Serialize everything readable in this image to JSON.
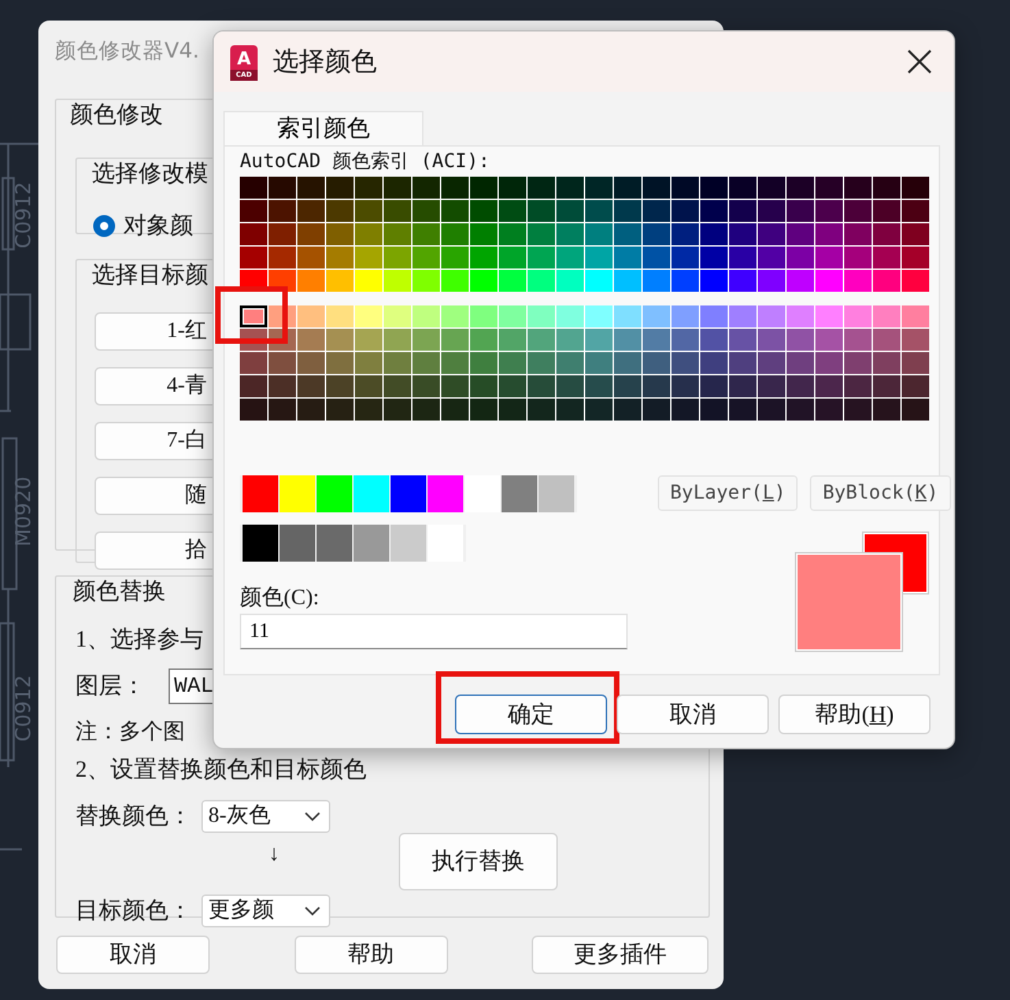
{
  "background": {
    "cad_labels": [
      "C0912",
      "M0920",
      "C0912"
    ]
  },
  "modifier_window": {
    "title": "颜色修改器V4.",
    "modify_group": {
      "title": "颜色修改",
      "mode_group": {
        "title": "选择修改模",
        "options": [
          {
            "label": "对象颜",
            "selected": true
          }
        ]
      },
      "target_group": {
        "title": "选择目标颜",
        "buttons": [
          "1-红",
          "4-青",
          "7-白",
          "随",
          "拾"
        ]
      }
    },
    "replace_group": {
      "title": "颜色替换",
      "step1": "1、选择参与",
      "layer_label": "图层：",
      "layer_value": "WAL",
      "note": "注：多个图",
      "step2": "2、设置替换颜色和目标颜色",
      "replace_label": "替换颜色：",
      "replace_value": "8-灰色",
      "arrow": "↓",
      "target_label": "目标颜色：",
      "target_value": "更多颜",
      "execute_button": "执行替换"
    },
    "buttons": [
      "取消",
      "帮助",
      "更多插件"
    ]
  },
  "color_dialog": {
    "title": "选择颜色",
    "logo": {
      "letter": "A",
      "caption": "CAD"
    },
    "tabs": [
      {
        "label": "索引颜色",
        "selected": true
      }
    ],
    "aci_label": "AutoCAD 颜色索引 (ACI):",
    "aci_upper": [
      {
        "cells": [
          {
            "color": "#260000",
            "selected": false
          },
          {
            "color": "#260900",
            "selected": false
          },
          {
            "color": "#261300",
            "selected": false
          },
          {
            "color": "#261c00",
            "selected": false
          },
          {
            "color": "#262600",
            "selected": false
          },
          {
            "color": "#1c2600",
            "selected": false
          },
          {
            "color": "#132600",
            "selected": false
          },
          {
            "color": "#092600",
            "selected": false
          },
          {
            "color": "#002600",
            "selected": false
          },
          {
            "color": "#002609",
            "selected": false
          },
          {
            "color": "#002613",
            "selected": false
          },
          {
            "color": "#00261c",
            "selected": false
          },
          {
            "color": "#002626",
            "selected": false
          },
          {
            "color": "#001c26",
            "selected": false
          },
          {
            "color": "#001326",
            "selected": false
          },
          {
            "color": "#000926",
            "selected": false
          },
          {
            "color": "#000026",
            "selected": false
          },
          {
            "color": "#090026",
            "selected": false
          },
          {
            "color": "#130026",
            "selected": false
          },
          {
            "color": "#1c0026",
            "selected": false
          },
          {
            "color": "#260026",
            "selected": false
          },
          {
            "color": "#26001c",
            "selected": false
          },
          {
            "color": "#260013",
            "selected": false
          },
          {
            "color": "#260009",
            "selected": false
          }
        ]
      },
      {
        "cells": [
          {
            "color": "#4c0000",
            "selected": false
          },
          {
            "color": "#4c1300",
            "selected": false
          },
          {
            "color": "#4c2600",
            "selected": false
          },
          {
            "color": "#4c3900",
            "selected": false
          },
          {
            "color": "#4c4c00",
            "selected": false
          },
          {
            "color": "#394c00",
            "selected": false
          },
          {
            "color": "#264c00",
            "selected": false
          },
          {
            "color": "#134c00",
            "selected": false
          },
          {
            "color": "#004c00",
            "selected": false
          },
          {
            "color": "#004c13",
            "selected": false
          },
          {
            "color": "#004c26",
            "selected": false
          },
          {
            "color": "#004c39",
            "selected": false
          },
          {
            "color": "#004c4c",
            "selected": false
          },
          {
            "color": "#00394c",
            "selected": false
          },
          {
            "color": "#00264c",
            "selected": false
          },
          {
            "color": "#00134c",
            "selected": false
          },
          {
            "color": "#00004c",
            "selected": false
          },
          {
            "color": "#13004c",
            "selected": false
          },
          {
            "color": "#26004c",
            "selected": false
          },
          {
            "color": "#39004c",
            "selected": false
          },
          {
            "color": "#4c004c",
            "selected": false
          },
          {
            "color": "#4c0039",
            "selected": false
          },
          {
            "color": "#4c0026",
            "selected": false
          },
          {
            "color": "#4c0013",
            "selected": false
          }
        ]
      },
      {
        "cells": [
          {
            "color": "#7f0000",
            "selected": false
          },
          {
            "color": "#7f1f00",
            "selected": false
          },
          {
            "color": "#7f3f00",
            "selected": false
          },
          {
            "color": "#7f5f00",
            "selected": false
          },
          {
            "color": "#7f7f00",
            "selected": false
          },
          {
            "color": "#5f7f00",
            "selected": false
          },
          {
            "color": "#3f7f00",
            "selected": false
          },
          {
            "color": "#1f7f00",
            "selected": false
          },
          {
            "color": "#007f00",
            "selected": false
          },
          {
            "color": "#007f1f",
            "selected": false
          },
          {
            "color": "#007f3f",
            "selected": false
          },
          {
            "color": "#007f5f",
            "selected": false
          },
          {
            "color": "#007f7f",
            "selected": false
          },
          {
            "color": "#005f7f",
            "selected": false
          },
          {
            "color": "#003f7f",
            "selected": false
          },
          {
            "color": "#001f7f",
            "selected": false
          },
          {
            "color": "#00007f",
            "selected": false
          },
          {
            "color": "#1f007f",
            "selected": false
          },
          {
            "color": "#3f007f",
            "selected": false
          },
          {
            "color": "#5f007f",
            "selected": false
          },
          {
            "color": "#7f007f",
            "selected": false
          },
          {
            "color": "#7f005f",
            "selected": false
          },
          {
            "color": "#7f003f",
            "selected": false
          },
          {
            "color": "#7f001f",
            "selected": false
          }
        ]
      },
      {
        "cells": [
          {
            "color": "#a50000",
            "selected": false
          },
          {
            "color": "#a52900",
            "selected": false
          },
          {
            "color": "#a55200",
            "selected": false
          },
          {
            "color": "#a57c00",
            "selected": false
          },
          {
            "color": "#a5a500",
            "selected": false
          },
          {
            "color": "#7ca500",
            "selected": false
          },
          {
            "color": "#52a500",
            "selected": false
          },
          {
            "color": "#29a500",
            "selected": false
          },
          {
            "color": "#00a500",
            "selected": false
          },
          {
            "color": "#00a529",
            "selected": false
          },
          {
            "color": "#00a552",
            "selected": false
          },
          {
            "color": "#00a57c",
            "selected": false
          },
          {
            "color": "#00a5a5",
            "selected": false
          },
          {
            "color": "#007ca5",
            "selected": false
          },
          {
            "color": "#0052a5",
            "selected": false
          },
          {
            "color": "#0029a5",
            "selected": false
          },
          {
            "color": "#0000a5",
            "selected": false
          },
          {
            "color": "#2900a5",
            "selected": false
          },
          {
            "color": "#5200a5",
            "selected": false
          },
          {
            "color": "#7c00a5",
            "selected": false
          },
          {
            "color": "#a500a5",
            "selected": false
          },
          {
            "color": "#a5007c",
            "selected": false
          },
          {
            "color": "#a50052",
            "selected": false
          },
          {
            "color": "#a50029",
            "selected": false
          }
        ]
      },
      {
        "cells": [
          {
            "color": "#ff0000",
            "selected": false
          },
          {
            "color": "#ff3f00",
            "selected": false
          },
          {
            "color": "#ff7f00",
            "selected": false
          },
          {
            "color": "#ffbf00",
            "selected": false
          },
          {
            "color": "#ffff00",
            "selected": false
          },
          {
            "color": "#bfff00",
            "selected": false
          },
          {
            "color": "#7fff00",
            "selected": false
          },
          {
            "color": "#3fff00",
            "selected": false
          },
          {
            "color": "#00ff00",
            "selected": false
          },
          {
            "color": "#00ff3f",
            "selected": false
          },
          {
            "color": "#00ff7f",
            "selected": false
          },
          {
            "color": "#00ffbf",
            "selected": false
          },
          {
            "color": "#00ffff",
            "selected": false
          },
          {
            "color": "#00bfff",
            "selected": false
          },
          {
            "color": "#007fff",
            "selected": false
          },
          {
            "color": "#003fff",
            "selected": false
          },
          {
            "color": "#0000ff",
            "selected": false
          },
          {
            "color": "#3f00ff",
            "selected": false
          },
          {
            "color": "#7f00ff",
            "selected": false
          },
          {
            "color": "#bf00ff",
            "selected": false
          },
          {
            "color": "#ff00ff",
            "selected": false
          },
          {
            "color": "#ff00bf",
            "selected": false
          },
          {
            "color": "#ff007f",
            "selected": false
          },
          {
            "color": "#ff003f",
            "selected": false
          }
        ]
      }
    ],
    "aci_lower": [
      {
        "cells": [
          {
            "color": "#ff7f7f",
            "selected": true
          },
          {
            "color": "#ff9f7f",
            "selected": false
          },
          {
            "color": "#ffbf7f",
            "selected": false
          },
          {
            "color": "#ffdf7f",
            "selected": false
          },
          {
            "color": "#ffff7f",
            "selected": false
          },
          {
            "color": "#dfff7f",
            "selected": false
          },
          {
            "color": "#bfff7f",
            "selected": false
          },
          {
            "color": "#9fff7f",
            "selected": false
          },
          {
            "color": "#7fff7f",
            "selected": false
          },
          {
            "color": "#7fff9f",
            "selected": false
          },
          {
            "color": "#7fffbf",
            "selected": false
          },
          {
            "color": "#7fffdf",
            "selected": false
          },
          {
            "color": "#7fffff",
            "selected": false
          },
          {
            "color": "#7fdfff",
            "selected": false
          },
          {
            "color": "#7fbfff",
            "selected": false
          },
          {
            "color": "#7f9fff",
            "selected": false
          },
          {
            "color": "#7f7fff",
            "selected": false
          },
          {
            "color": "#9f7fff",
            "selected": false
          },
          {
            "color": "#bf7fff",
            "selected": false
          },
          {
            "color": "#df7fff",
            "selected": false
          },
          {
            "color": "#ff7fff",
            "selected": false
          },
          {
            "color": "#ff7fdf",
            "selected": false
          },
          {
            "color": "#ff7fbf",
            "selected": false
          },
          {
            "color": "#ff7f9f",
            "selected": false
          }
        ]
      },
      {
        "cells": [
          {
            "color": "#a55252",
            "selected": false
          },
          {
            "color": "#a56752",
            "selected": false
          },
          {
            "color": "#a57c52",
            "selected": false
          },
          {
            "color": "#a59052",
            "selected": false
          },
          {
            "color": "#a5a552",
            "selected": false
          },
          {
            "color": "#90a552",
            "selected": false
          },
          {
            "color": "#7ca552",
            "selected": false
          },
          {
            "color": "#67a552",
            "selected": false
          },
          {
            "color": "#52a552",
            "selected": false
          },
          {
            "color": "#52a567",
            "selected": false
          },
          {
            "color": "#52a57c",
            "selected": false
          },
          {
            "color": "#52a590",
            "selected": false
          },
          {
            "color": "#52a5a5",
            "selected": false
          },
          {
            "color": "#5290a5",
            "selected": false
          },
          {
            "color": "#527ca5",
            "selected": false
          },
          {
            "color": "#5267a5",
            "selected": false
          },
          {
            "color": "#5252a5",
            "selected": false
          },
          {
            "color": "#6752a5",
            "selected": false
          },
          {
            "color": "#7c52a5",
            "selected": false
          },
          {
            "color": "#9052a5",
            "selected": false
          },
          {
            "color": "#a552a5",
            "selected": false
          },
          {
            "color": "#a55290",
            "selected": false
          },
          {
            "color": "#a5527c",
            "selected": false
          },
          {
            "color": "#a55267",
            "selected": false
          }
        ]
      },
      {
        "cells": [
          {
            "color": "#7f3f3f",
            "selected": false
          },
          {
            "color": "#7f4f3f",
            "selected": false
          },
          {
            "color": "#7f5f3f",
            "selected": false
          },
          {
            "color": "#7f6f3f",
            "selected": false
          },
          {
            "color": "#7f7f3f",
            "selected": false
          },
          {
            "color": "#6f7f3f",
            "selected": false
          },
          {
            "color": "#5f7f3f",
            "selected": false
          },
          {
            "color": "#4f7f3f",
            "selected": false
          },
          {
            "color": "#3f7f3f",
            "selected": false
          },
          {
            "color": "#3f7f4f",
            "selected": false
          },
          {
            "color": "#3f7f5f",
            "selected": false
          },
          {
            "color": "#3f7f6f",
            "selected": false
          },
          {
            "color": "#3f7f7f",
            "selected": false
          },
          {
            "color": "#3f6f7f",
            "selected": false
          },
          {
            "color": "#3f5f7f",
            "selected": false
          },
          {
            "color": "#3f4f7f",
            "selected": false
          },
          {
            "color": "#3f3f7f",
            "selected": false
          },
          {
            "color": "#4f3f7f",
            "selected": false
          },
          {
            "color": "#5f3f7f",
            "selected": false
          },
          {
            "color": "#6f3f7f",
            "selected": false
          },
          {
            "color": "#7f3f7f",
            "selected": false
          },
          {
            "color": "#7f3f6f",
            "selected": false
          },
          {
            "color": "#7f3f5f",
            "selected": false
          },
          {
            "color": "#7f3f4f",
            "selected": false
          }
        ]
      },
      {
        "cells": [
          {
            "color": "#4c2626",
            "selected": false
          },
          {
            "color": "#4c2f26",
            "selected": false
          },
          {
            "color": "#4c3926",
            "selected": false
          },
          {
            "color": "#4c4226",
            "selected": false
          },
          {
            "color": "#4c4c26",
            "selected": false
          },
          {
            "color": "#424c26",
            "selected": false
          },
          {
            "color": "#394c26",
            "selected": false
          },
          {
            "color": "#2f4c26",
            "selected": false
          },
          {
            "color": "#264c26",
            "selected": false
          },
          {
            "color": "#264c2f",
            "selected": false
          },
          {
            "color": "#264c39",
            "selected": false
          },
          {
            "color": "#264c42",
            "selected": false
          },
          {
            "color": "#264c4c",
            "selected": false
          },
          {
            "color": "#26424c",
            "selected": false
          },
          {
            "color": "#26394c",
            "selected": false
          },
          {
            "color": "#262f4c",
            "selected": false
          },
          {
            "color": "#26264c",
            "selected": false
          },
          {
            "color": "#2f264c",
            "selected": false
          },
          {
            "color": "#39264c",
            "selected": false
          },
          {
            "color": "#42264c",
            "selected": false
          },
          {
            "color": "#4c264c",
            "selected": false
          },
          {
            "color": "#4c2642",
            "selected": false
          },
          {
            "color": "#4c2639",
            "selected": false
          },
          {
            "color": "#4c262f",
            "selected": false
          }
        ]
      },
      {
        "cells": [
          {
            "color": "#261313",
            "selected": false
          },
          {
            "color": "#261713",
            "selected": false
          },
          {
            "color": "#261c13",
            "selected": false
          },
          {
            "color": "#262113",
            "selected": false
          },
          {
            "color": "#262613",
            "selected": false
          },
          {
            "color": "#212613",
            "selected": false
          },
          {
            "color": "#1c2613",
            "selected": false
          },
          {
            "color": "#172613",
            "selected": false
          },
          {
            "color": "#132613",
            "selected": false
          },
          {
            "color": "#132617",
            "selected": false
          },
          {
            "color": "#13261c",
            "selected": false
          },
          {
            "color": "#132621",
            "selected": false
          },
          {
            "color": "#132626",
            "selected": false
          },
          {
            "color": "#132126",
            "selected": false
          },
          {
            "color": "#131c26",
            "selected": false
          },
          {
            "color": "#131726",
            "selected": false
          },
          {
            "color": "#131326",
            "selected": false
          },
          {
            "color": "#171326",
            "selected": false
          },
          {
            "color": "#1c1326",
            "selected": false
          },
          {
            "color": "#211326",
            "selected": false
          },
          {
            "color": "#261326",
            "selected": false
          },
          {
            "color": "#261321",
            "selected": false
          },
          {
            "color": "#26131c",
            "selected": false
          },
          {
            "color": "#261317",
            "selected": false
          }
        ]
      }
    ],
    "highlight_selected": true,
    "standard_colors": [
      {
        "color": "#ff0000",
        "selected": false
      },
      {
        "color": "#ffff00",
        "selected": false
      },
      {
        "color": "#00ff00",
        "selected": false
      },
      {
        "color": "#00ffff",
        "selected": false
      },
      {
        "color": "#0000ff",
        "selected": false
      },
      {
        "color": "#ff00ff",
        "selected": false
      },
      {
        "color": "#ffffff",
        "selected": false
      },
      {
        "color": "#808080",
        "selected": false
      },
      {
        "color": "#c0c0c0",
        "selected": false
      }
    ],
    "gray_colors": [
      {
        "color": "#000000",
        "selected": false
      },
      {
        "color": "#656565",
        "selected": false
      },
      {
        "color": "#6a6a6a",
        "selected": false
      },
      {
        "color": "#999999",
        "selected": false
      },
      {
        "color": "#cbcbcb",
        "selected": false
      },
      {
        "color": "#ffffff",
        "selected": false
      }
    ],
    "bylayer_button": {
      "label": "ByLayer(",
      "mnemonic": "L",
      "tail": ")"
    },
    "byblock_button": {
      "label": "ByBlock(",
      "mnemonic": "K",
      "tail": ")"
    },
    "color_label": "颜色(C):",
    "color_value": "11",
    "preview": {
      "new": {
        "color": "#ff7f7f"
      },
      "old": {
        "color": "#ff0000"
      }
    },
    "buttons": [
      {
        "label": "确定",
        "default": true,
        "highlight": true
      },
      {
        "label": "取消",
        "default": false,
        "highlight": false
      },
      {
        "label": "帮助(",
        "mnemonic": "H",
        "tail": ")",
        "default": false,
        "highlight": false
      }
    ]
  }
}
